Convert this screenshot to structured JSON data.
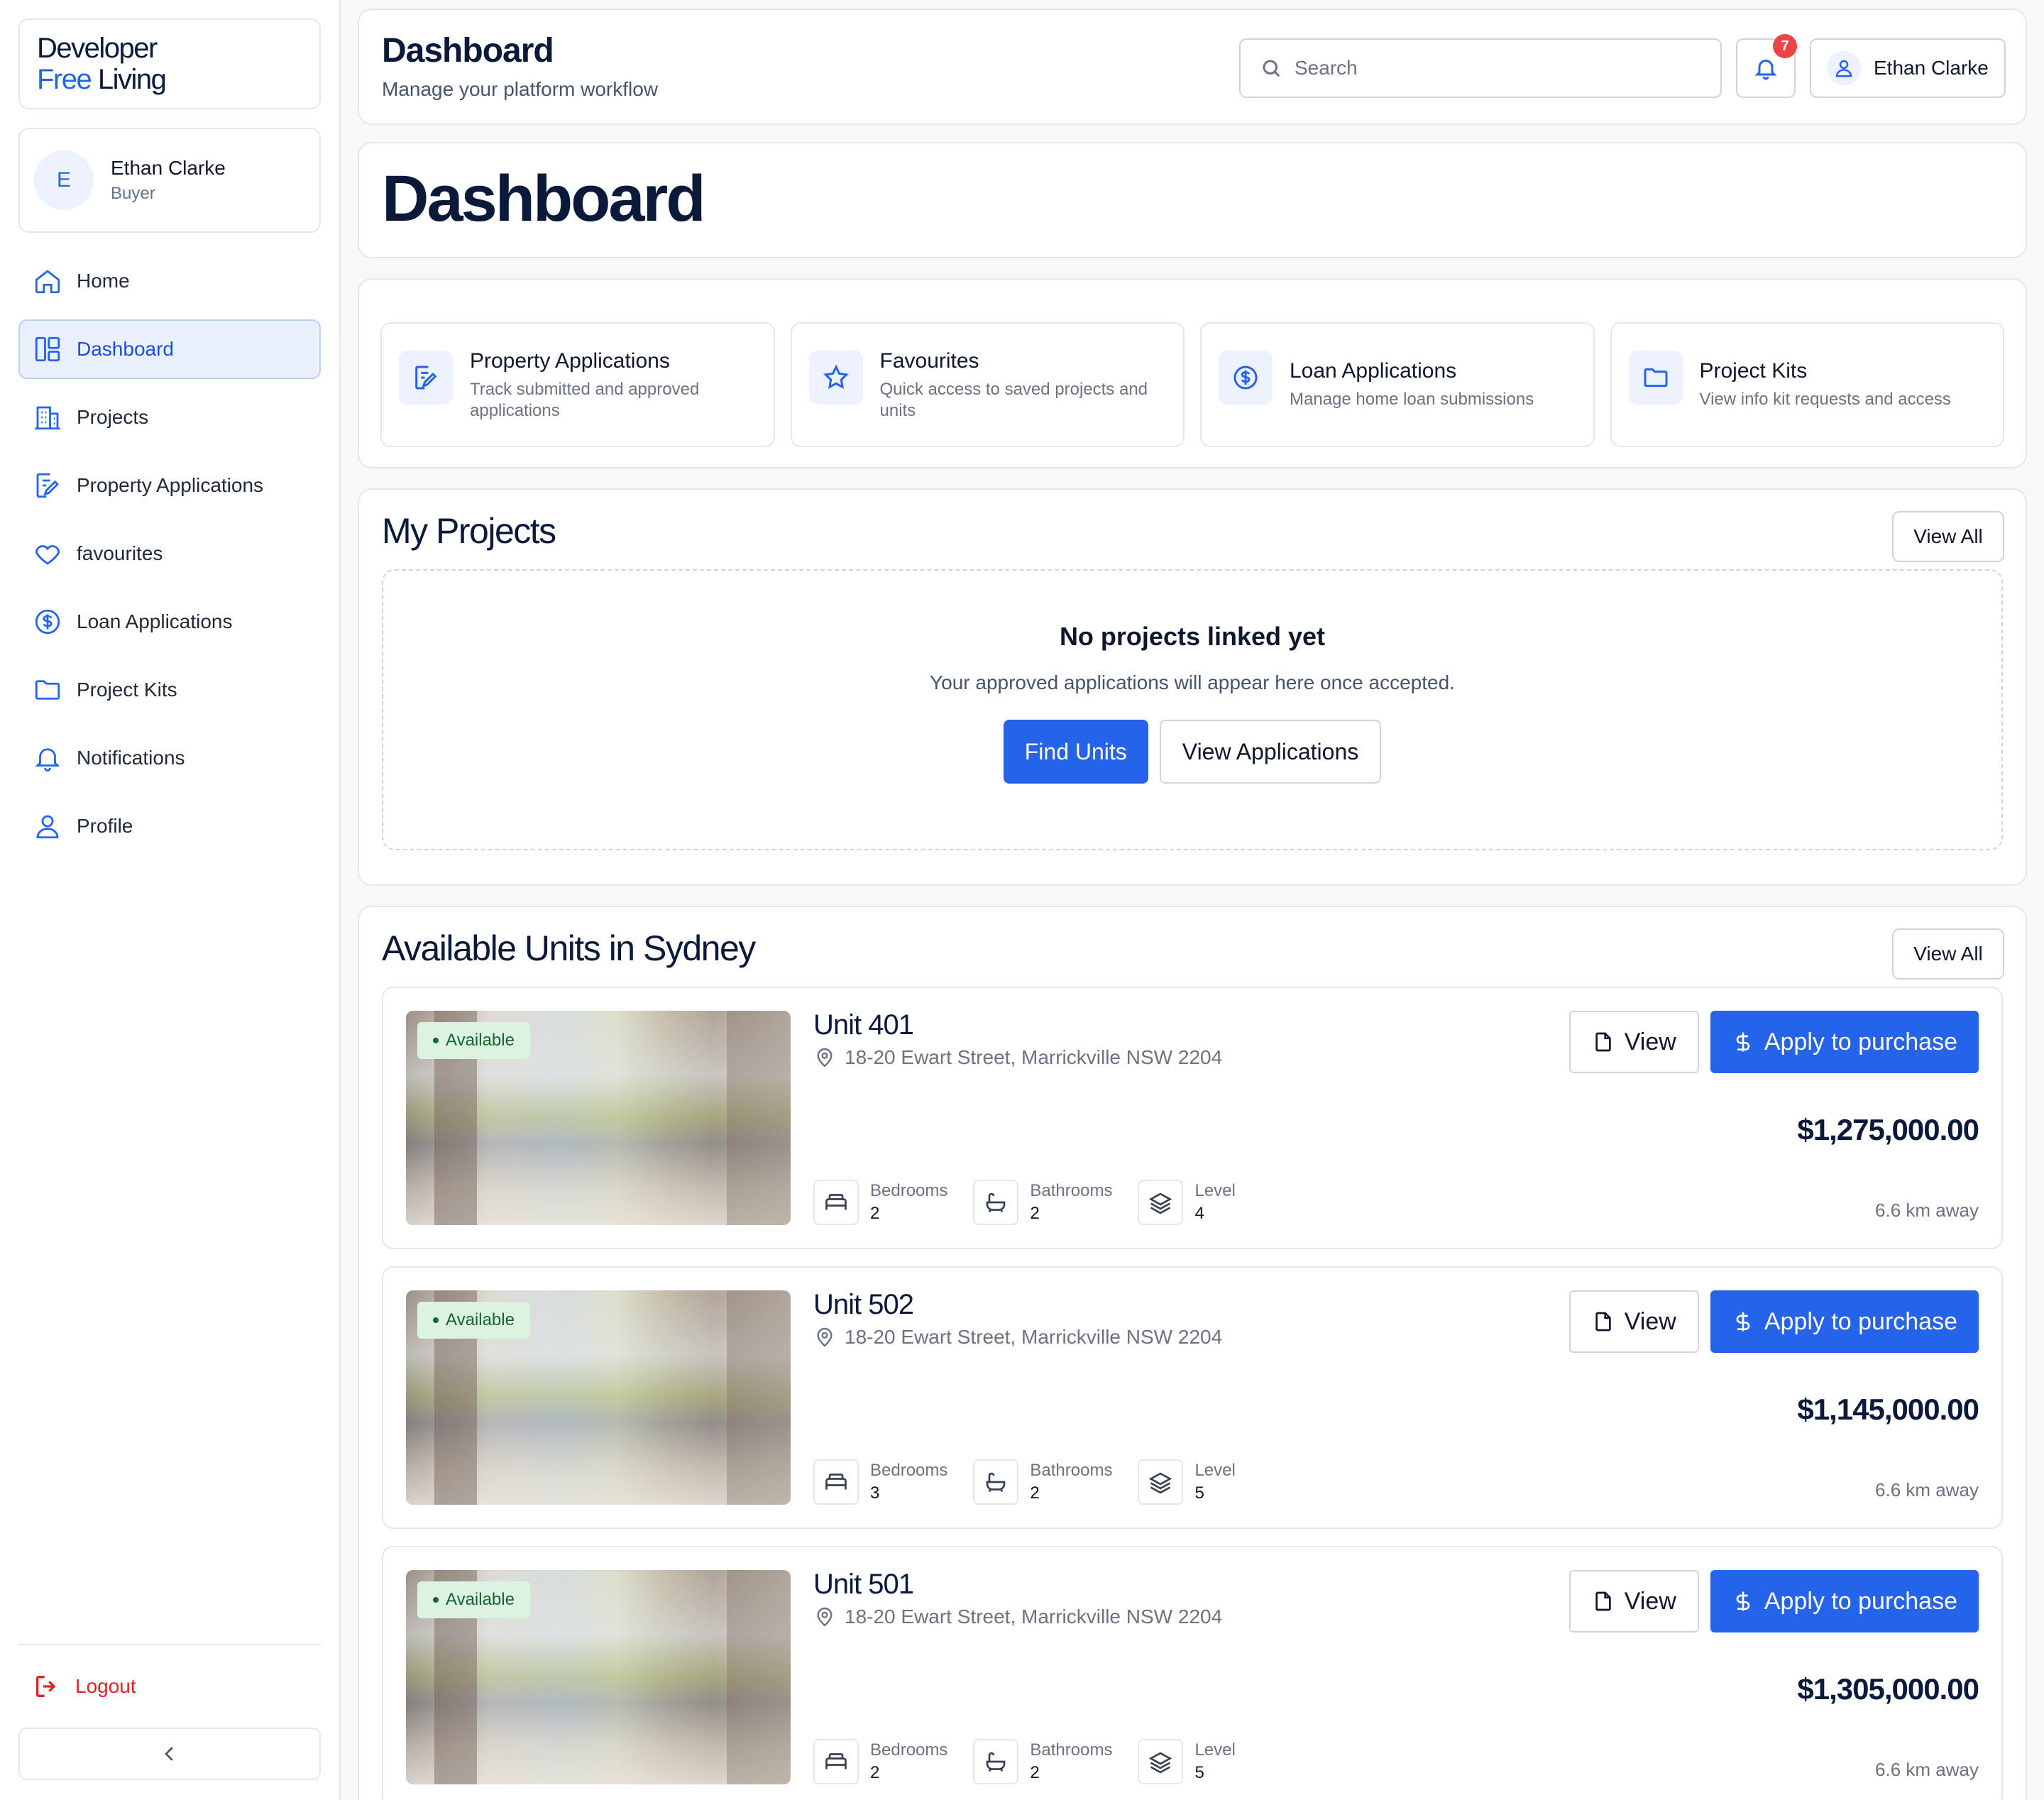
{
  "brand": {
    "line1": "Developer",
    "line2_accent": "Free",
    "line2_rest": " Living"
  },
  "user": {
    "initial": "E",
    "name": "Ethan Clarke",
    "role": "Buyer"
  },
  "sidebar": {
    "items": [
      {
        "label": "Home",
        "icon": "home-icon"
      },
      {
        "label": "Dashboard",
        "icon": "dashboard-icon",
        "active": true
      },
      {
        "label": "Projects",
        "icon": "building-icon"
      },
      {
        "label": "Property Applications",
        "icon": "application-icon"
      },
      {
        "label": "favourites",
        "icon": "heart-icon"
      },
      {
        "label": "Loan Applications",
        "icon": "dollar-icon"
      },
      {
        "label": "Project Kits",
        "icon": "folder-icon"
      },
      {
        "label": "Notifications",
        "icon": "bell-icon"
      },
      {
        "label": "Profile",
        "icon": "user-icon"
      }
    ],
    "logout": "Logout"
  },
  "header": {
    "title": "Dashboard",
    "subtitle": "Manage your platform workflow",
    "search_placeholder": "Search",
    "notification_count": "7",
    "user_name": "Ethan Clarke"
  },
  "hero": {
    "title": "Dashboard"
  },
  "quick_links": [
    {
      "title": "Property Applications",
      "desc": "Track submitted and approved applications",
      "icon": "application-icon"
    },
    {
      "title": "Favourites",
      "desc": "Quick access to saved projects and units",
      "icon": "star-icon"
    },
    {
      "title": "Loan Applications",
      "desc": "Manage home loan submissions",
      "icon": "dollar-icon"
    },
    {
      "title": "Project Kits",
      "desc": "View info kit requests and access",
      "icon": "folder-icon"
    }
  ],
  "projects": {
    "title": "My Projects",
    "view_all": "View All",
    "empty_title": "No projects linked yet",
    "empty_sub": "Your approved applications will appear here once accepted.",
    "find_units": "Find Units",
    "view_applications": "View Applications"
  },
  "units": {
    "title": "Available Units in Sydney",
    "view_all": "View All",
    "labels": {
      "available": "Available",
      "bedrooms": "Bedrooms",
      "bathrooms": "Bathrooms",
      "level": "Level",
      "view": "View",
      "apply": "Apply to purchase"
    },
    "items": [
      {
        "name": "Unit 401",
        "address": "18-20 Ewart Street, Marrickville NSW 2204",
        "bedrooms": "2",
        "bathrooms": "2",
        "level": "4",
        "price": "$1,275,000.00",
        "distance": "6.6 km away"
      },
      {
        "name": "Unit 502",
        "address": "18-20 Ewart Street, Marrickville NSW 2204",
        "bedrooms": "3",
        "bathrooms": "2",
        "level": "5",
        "price": "$1,145,000.00",
        "distance": "6.6 km away"
      },
      {
        "name": "Unit 501",
        "address": "18-20 Ewart Street, Marrickville NSW 2204",
        "bedrooms": "2",
        "bathrooms": "2",
        "level": "5",
        "price": "$1,305,000.00",
        "distance": "6.6 km away"
      }
    ]
  },
  "colors": {
    "accent": "#2563eb",
    "danger": "#dc2626",
    "available_bg": "#dcf3df"
  }
}
